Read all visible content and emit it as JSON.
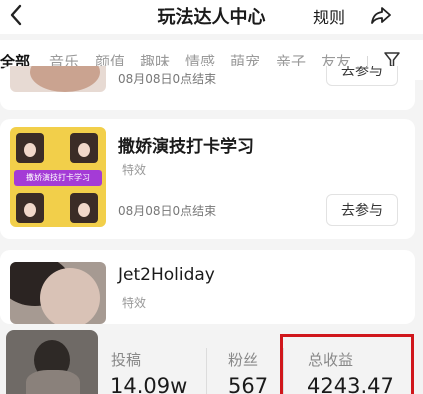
{
  "header": {
    "title": "玩法达人中心",
    "rules_label": "规则"
  },
  "tabs": [
    "全部",
    "音乐",
    "颜值",
    "趣味",
    "情感",
    "萌宠",
    "亲子",
    "友友"
  ],
  "cards": [
    {
      "time": "08月08日0点结束",
      "join_label": "去参与"
    },
    {
      "name": "撒娇演技打卡学习",
      "tag": "特效",
      "time": "08月08日0点结束",
      "join_label": "去参与",
      "thumb_banner": "撒娇演技打卡学习"
    },
    {
      "name": "Jet2Holiday",
      "tag": "特效"
    }
  ],
  "stats": {
    "posts": {
      "label": "投稿",
      "value": "14.09w"
    },
    "fans": {
      "label": "粉丝",
      "value": "567"
    },
    "earnings": {
      "label": "总收益",
      "value": "4243.47"
    }
  },
  "colors": {
    "highlight_box": "#d0161b",
    "thumb_yellow": "#f2cf4a",
    "banner_purple": "#a43bd6"
  },
  "icons": {
    "back": "chevron-left-icon",
    "share": "share-arrow-icon",
    "filter": "filter-funnel-icon"
  }
}
